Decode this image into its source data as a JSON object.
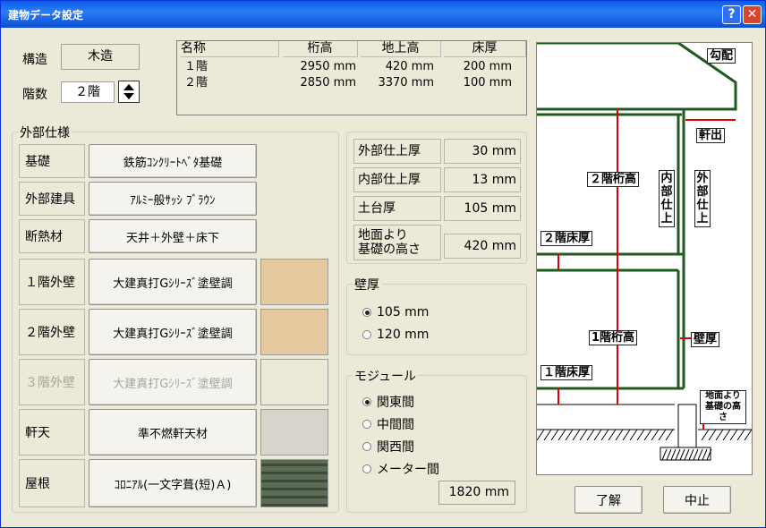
{
  "window": {
    "title": "建物データ設定",
    "help": "?",
    "close": "✕"
  },
  "structure": {
    "label": "構造",
    "value": "木造"
  },
  "floors": {
    "label": "階数",
    "value": "２階"
  },
  "floor_table": {
    "headers": [
      "名称",
      "桁高",
      "地上高",
      "床厚"
    ],
    "rows": [
      [
        "１階",
        "2950 mm",
        "420 mm",
        "200 mm"
      ],
      [
        "２階",
        "2850 mm",
        "3370 mm",
        "100 mm"
      ]
    ]
  },
  "exterior": {
    "title": "外部仕様",
    "rows": [
      {
        "label": "基礎",
        "value": "鉄筋ｺﾝｸﾘｰﾄﾍﾞﾀ基礎",
        "enabled": true
      },
      {
        "label": "外部建具",
        "value": "ｱﾙﾐｰ般ｻｯｼ ﾌﾞﾗｳﾝ",
        "enabled": true
      },
      {
        "label": "断熱材",
        "value": "天井＋外壁＋床下",
        "enabled": true
      },
      {
        "label": "１階外壁",
        "value": "大建真打Gｼﾘｰｽﾞ塗壁調",
        "enabled": true,
        "swatch": "#e3c99d"
      },
      {
        "label": "２階外壁",
        "value": "大建真打Gｼﾘｰｽﾞ塗壁調",
        "enabled": true,
        "swatch": "#e3c99d"
      },
      {
        "label": "３階外壁",
        "value": "大建真打Gｼﾘｰｽﾞ塗壁調",
        "enabled": false,
        "swatch": "#ece9d8"
      },
      {
        "label": "軒天",
        "value": "準不燃軒天材",
        "enabled": true,
        "swatch": "#d8d4cc"
      },
      {
        "label": "屋根",
        "value": "ｺﾛﾆｱﾙ(一文字葺(短)Ａ)",
        "enabled": true,
        "swatch": "#4b5a46"
      }
    ]
  },
  "finish": {
    "rows": [
      {
        "label": "外部仕上厚",
        "value": "30 mm"
      },
      {
        "label": "内部仕上厚",
        "value": "13 mm"
      },
      {
        "label": "土台厚",
        "value": "105 mm"
      },
      {
        "label": "地面より\n基礎の高さ",
        "value": "420 mm"
      }
    ]
  },
  "wall_thickness": {
    "title": "壁厚",
    "options": [
      "105 mm",
      "120 mm"
    ],
    "selected": "105 mm"
  },
  "module": {
    "title": "モジュール",
    "options": [
      "関東間",
      "中間間",
      "関西間",
      "メーター間"
    ],
    "selected": "関東間",
    "value": "1820 mm"
  },
  "diagram": {
    "labels": {
      "slope": "勾配",
      "eave": "軒出",
      "f2_height": "２階桁高",
      "f2_floor": "２階床厚",
      "f1_height": "1階桁高",
      "f1_floor": "１階床厚",
      "wall": "壁厚",
      "inner": "内部仕上",
      "outer": "外部仕上",
      "base": "地面より基礎の高さ"
    },
    "wall_color": "#1f5a1f",
    "arrow_color": "#e00000"
  },
  "buttons": {
    "ok": "了解",
    "cancel": "中止"
  }
}
